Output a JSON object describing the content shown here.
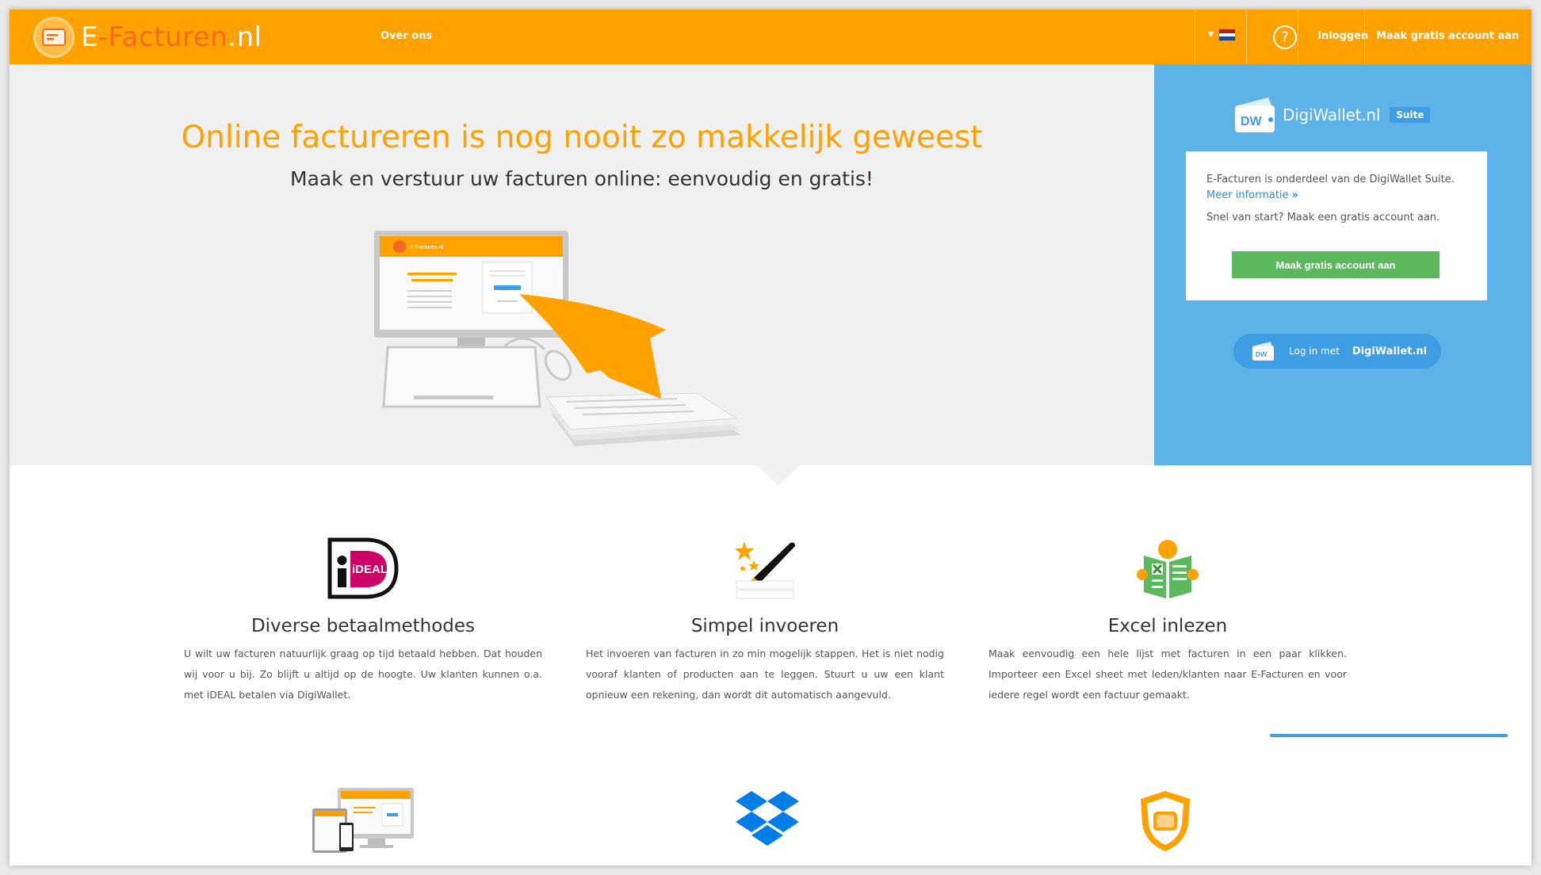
{
  "brand": {
    "name_prefix": "E",
    "name_mid": "-Facturen",
    "name_suffix": ".nl"
  },
  "nav": {
    "about": "Over ons",
    "language": "Nederlands",
    "help_glyph": "?",
    "login": "Inloggen",
    "signup": "Maak gratis account aan"
  },
  "hero": {
    "title": "Online factureren is nog nooit zo makkelijk geweest",
    "subtitle": "Maak en verstuur uw facturen online: eenvoudig en gratis!",
    "mockup_label": "E-Facturen.nl"
  },
  "digiwallet": {
    "name": "DigiWallet.nl",
    "suite": "Suite",
    "info": "E-Facturen is onderdeel van de DigiWallet Suite.",
    "more": "Meer informatie",
    "quick": "Snel van start? Maak een gratis account aan.",
    "create_btn": "Maak gratis account aan",
    "login_label": "Log in met",
    "login_brand": "DigiWallet.nl"
  },
  "features": [
    {
      "icon": "ideal-icon",
      "title": "Diverse betaalmethodes",
      "desc": "U wilt uw facturen natuurlijk graag op tijd betaald hebben. Dat houden wij voor u bij. Zo blijft u altijd op de hoogte. Uw klanten kunnen o.a. met iDEAL betalen via DigiWallet."
    },
    {
      "icon": "pen-stars-icon",
      "title": "Simpel invoeren",
      "desc": "Het invoeren van facturen in zo min mogelijk stappen. Het is niet nodig vooraf klanten of producten aan te leggen. Stuurt u uw een klant opnieuw een rekening, dan wordt dit automatisch aangevuld."
    },
    {
      "icon": "excel-reader-icon",
      "title": "Excel inlezen",
      "desc": "Maak eenvoudig een hele lijst met facturen in een paar klikken. Importeer een Excel sheet met leden/klanten naar E-Facturen en voor iedere regel wordt een factuur gemaakt."
    }
  ],
  "feature_ideal_text": "iDEAL",
  "bottom_icons": [
    "devices-icon",
    "dropbox-icon",
    "shield-icon"
  ],
  "colors": {
    "brand_orange": "#ffa200",
    "panel_blue": "#5db3e8",
    "button_green": "#5cb85c",
    "link_blue": "#2f8bd6"
  }
}
